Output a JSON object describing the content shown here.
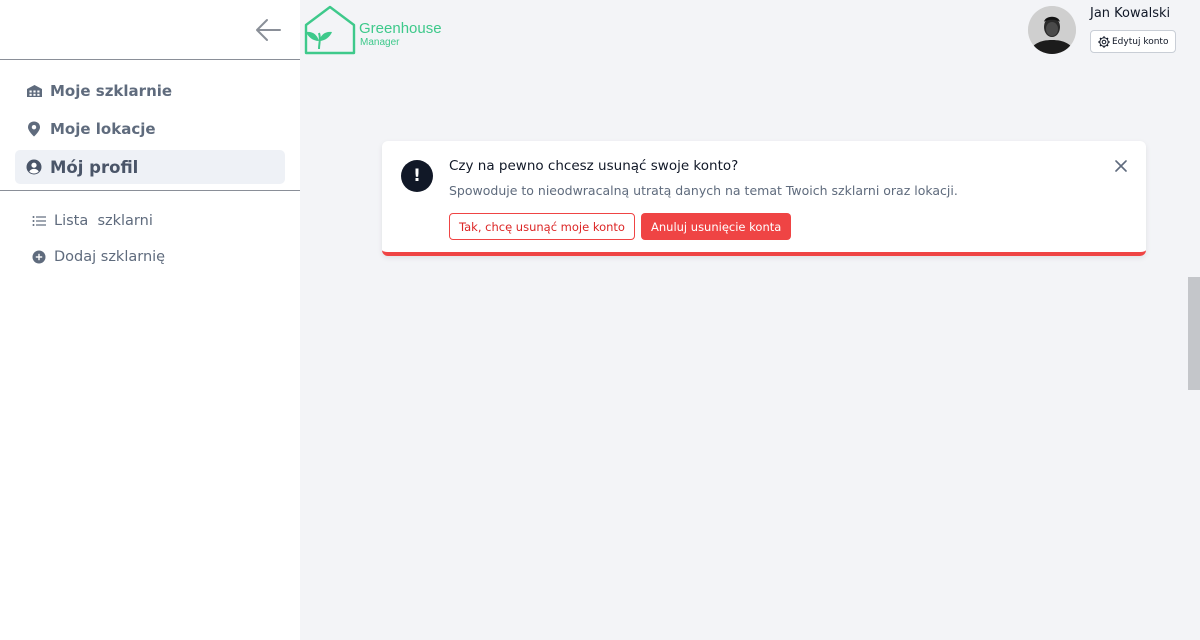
{
  "colors": {
    "accent_green": "#3ec98b",
    "danger": "#ef4444",
    "nav_text": "#5f6b7d"
  },
  "logo": {
    "title": "Greenhouse",
    "subtitle": "Manager"
  },
  "sidebar": {
    "back_icon": "arrow-left-icon",
    "main_items": [
      {
        "label": "Moje szklarnie",
        "icon": "warehouse-icon"
      },
      {
        "label": "Moje lokacje",
        "icon": "map-pin-icon"
      },
      {
        "label": "Mój profil",
        "icon": "user-circle-icon",
        "active": true
      }
    ],
    "sub_items": [
      {
        "label": "Lista  szklarni",
        "icon": "list-icon"
      },
      {
        "label": "Dodaj szklarnię",
        "icon": "plus-circle-icon"
      }
    ]
  },
  "user": {
    "name": "Jan Kowalski",
    "edit_label": "Edytuj konto",
    "edit_icon": "gear-icon"
  },
  "alert": {
    "icon": "exclamation-icon",
    "title": "Czy na pewno chcesz usunąć swoje konto?",
    "message": "Spowoduje to nieodwracalną utratą danych na temat Twoich szklarni oraz lokacji.",
    "confirm_label": "Tak, chcę usunąć moje konto",
    "cancel_label": "Anuluj usunięcie konta"
  }
}
